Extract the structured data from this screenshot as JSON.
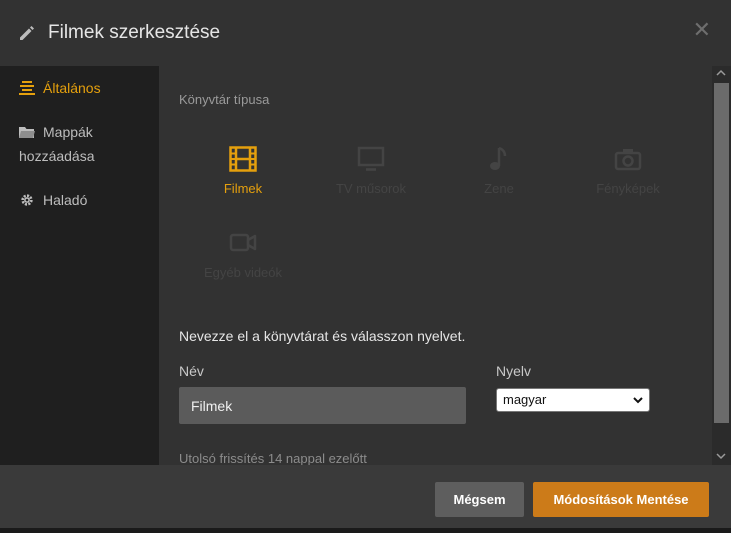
{
  "header": {
    "title": "Filmek szerkesztése",
    "pencil_icon": "pencil-icon",
    "close_icon": "close-icon",
    "close_glyph": "✕"
  },
  "sidebar": {
    "items": [
      {
        "label": "Általános",
        "icon": "general-icon",
        "active": true
      },
      {
        "label": "Mappák hozzáadása",
        "icon": "folder-icon",
        "active": false
      },
      {
        "label": "Haladó",
        "icon": "gear-icon",
        "active": false
      }
    ]
  },
  "content": {
    "section_label": "Könyvtár típusa",
    "types": [
      {
        "label": "Filmek",
        "icon": "film-icon",
        "selected": true
      },
      {
        "label": "TV műsorok",
        "icon": "tv-icon",
        "selected": false
      },
      {
        "label": "Zene",
        "icon": "music-icon",
        "selected": false
      },
      {
        "label": "Fényképek",
        "icon": "camera-icon",
        "selected": false
      },
      {
        "label": "Egyéb videók",
        "icon": "video-camera-icon",
        "selected": false
      }
    ],
    "instruction": "Nevezze el a könyvtárat és válasszon nyelvet.",
    "name_label": "Név",
    "name_value": "Filmek",
    "language_label": "Nyelv",
    "language_value": "magyar",
    "last_refresh": "Utolsó frissítés 14 nappal ezelőtt"
  },
  "footer": {
    "cancel_label": "Mégsem",
    "save_label": "Módosítások Mentése"
  },
  "colors": {
    "accent": "#e5a00d",
    "save_button": "#cc7b19",
    "cancel_button": "#5e5e5e",
    "panel": "#323232",
    "sidebar": "#1f1f1f"
  }
}
